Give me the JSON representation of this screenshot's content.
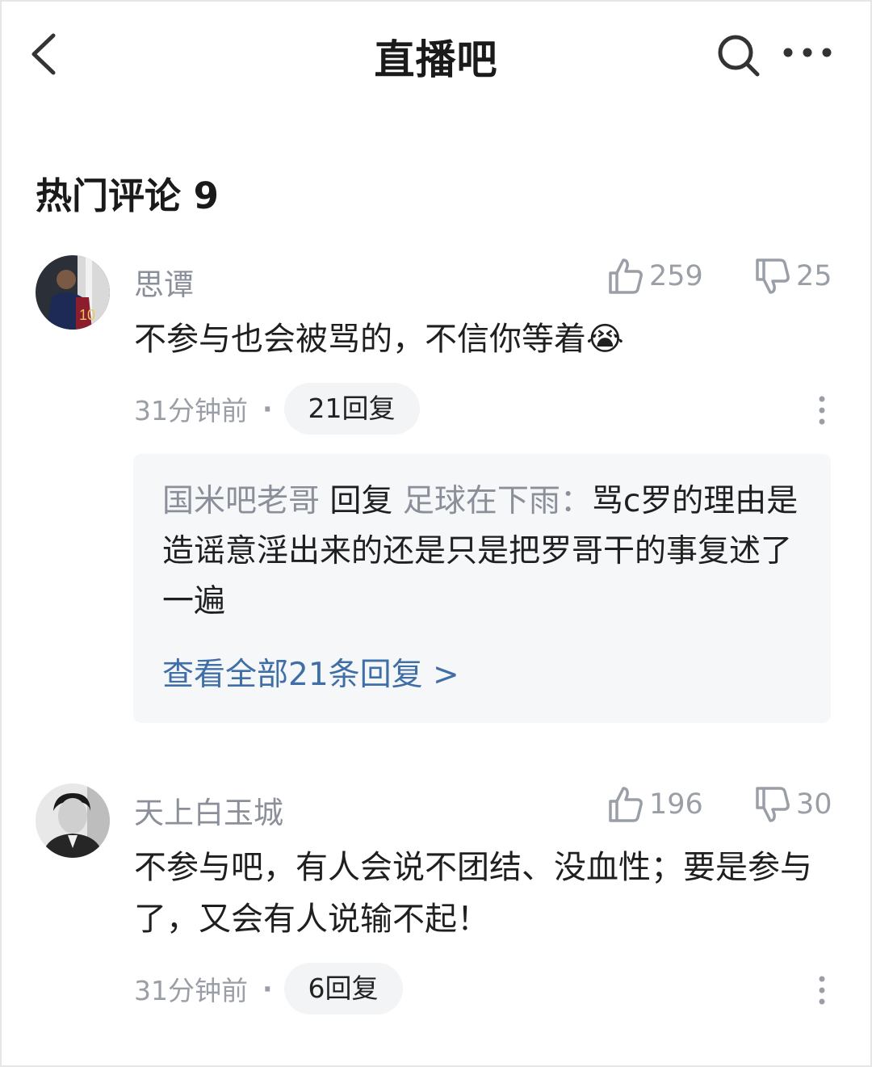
{
  "header": {
    "title": "直播吧"
  },
  "section": {
    "title": "热门评论 9"
  },
  "comments": [
    {
      "username": "思谭",
      "likes": "259",
      "dislikes": "25",
      "content": "不参与也会被骂的，不信你等着",
      "emoji": "😭",
      "time": "31分钟前",
      "dot": "·",
      "replies_label": "21回复",
      "reply_preview": {
        "from": "国米吧老哥",
        "verb": " 回复 ",
        "to": "足球在下雨：",
        "text": "骂c罗的理由是造谣意淫出来的还是只是把罗哥干的事复述了一遍"
      },
      "view_all": "查看全部21条回复 >"
    },
    {
      "username": "天上白玉城",
      "likes": "196",
      "dislikes": "30",
      "content": "不参与吧，有人会说不团结、没血性；要是参与了，又会有人说输不起！",
      "time": "31分钟前",
      "dot": "·",
      "replies_label": "6回复"
    }
  ],
  "icons": {
    "back": "chevron-left-icon",
    "search": "search-icon",
    "more": "more-horizontal-icon",
    "like": "thumbs-up-icon",
    "dislike": "thumbs-down-icon",
    "kebab": "more-vertical-icon"
  },
  "colors": {
    "link": "#3f6fa6",
    "muted": "#8a8f99",
    "reply_bg": "#f6f7f9"
  }
}
